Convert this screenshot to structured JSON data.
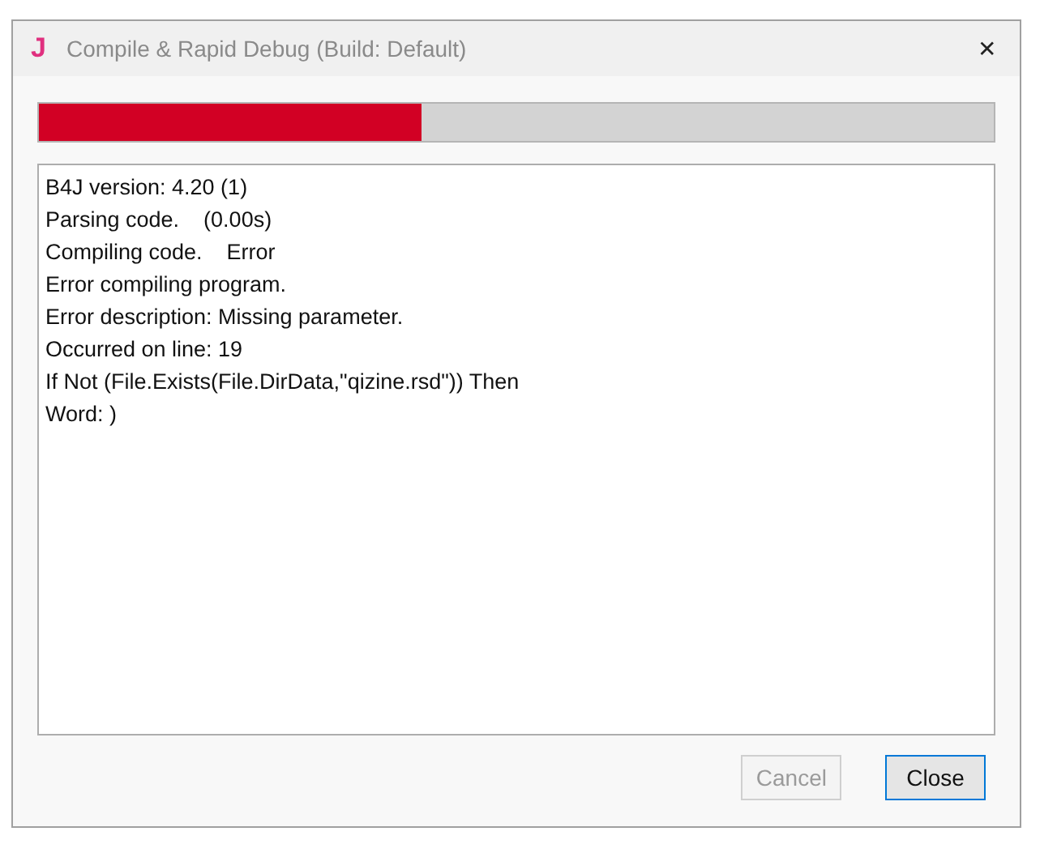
{
  "window": {
    "icon": "J",
    "title": "Compile & Rapid Debug (Build: Default)",
    "close": "✕"
  },
  "progress": {
    "level": 0.4
  },
  "log": [
    "B4J version: 4.20 (1)",
    "Parsing code.    (0.00s)",
    "Compiling code.    Error",
    "Error compiling program.",
    "Error description: Missing parameter.",
    "Occurred on line: 19",
    "If Not (File.Exists(File.DirData,\"qizine.rsd\")) Then",
    "Word: )"
  ],
  "buttons": [
    {
      "label": "Cancel",
      "disabled": true,
      "focused": false
    },
    {
      "label": "Close",
      "disabled": false,
      "focused": true
    }
  ]
}
